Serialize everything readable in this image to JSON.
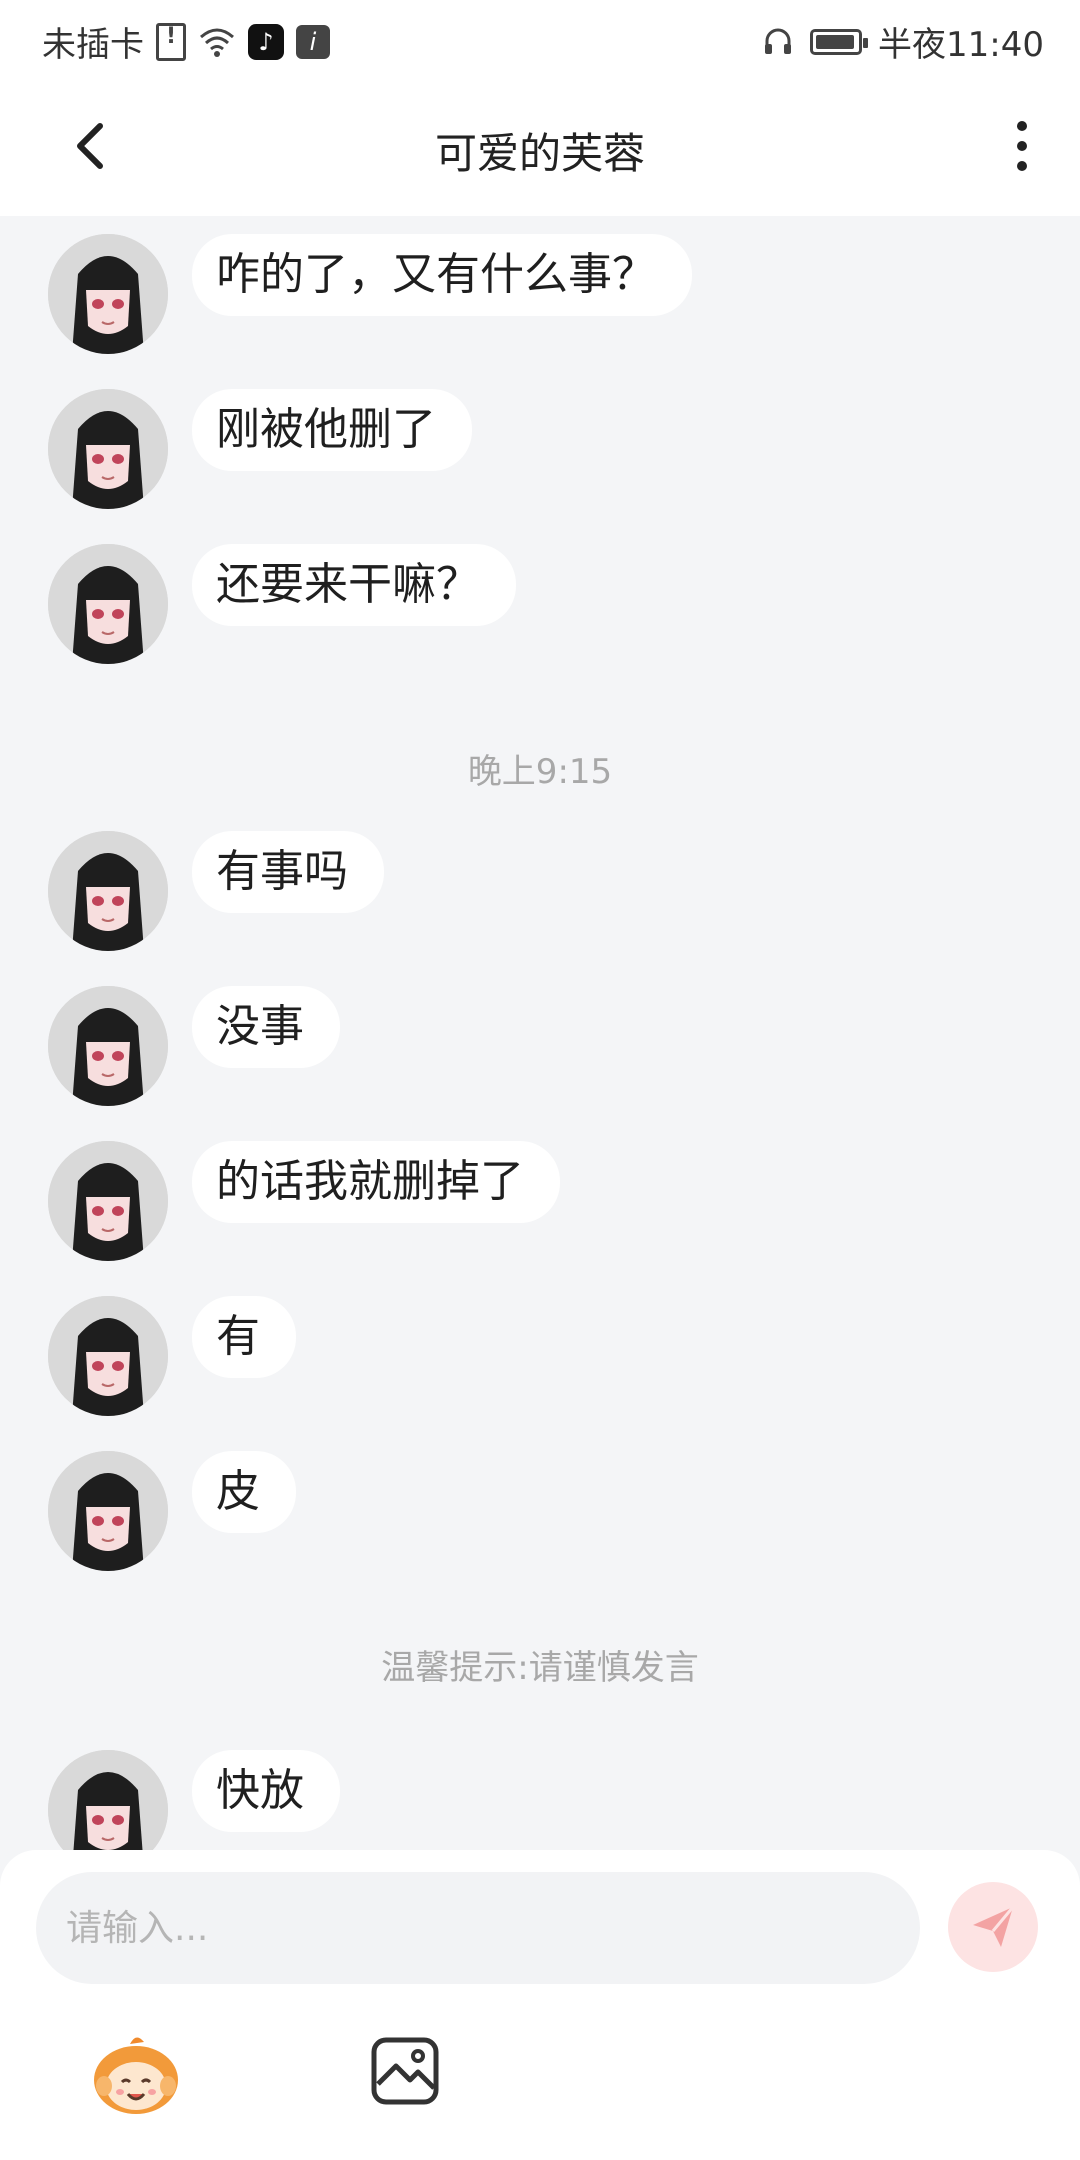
{
  "status_bar": {
    "carrier": "未插卡",
    "time": "半夜11:40",
    "icons": [
      "sim-alert-icon",
      "wifi-icon",
      "tiktok-icon",
      "info-icon",
      "headset-icon",
      "battery-icon"
    ]
  },
  "header": {
    "title": "可爱的芙蓉",
    "back_icon": "chevron-left-icon",
    "more_icon": "more-vertical-icon"
  },
  "messages": [
    {
      "text": "咋的了，又有什么事？"
    },
    {
      "text": "刚被他删了"
    },
    {
      "text": "还要来干嘛？"
    },
    {
      "text": "有事吗"
    },
    {
      "text": "没事"
    },
    {
      "text": "的话我就删掉了"
    },
    {
      "text": "有"
    },
    {
      "text": "皮"
    },
    {
      "text": "快放"
    }
  ],
  "system_labels": {
    "time_divider": "晚上9:15",
    "tip": "温馨提示:请谨慎发言"
  },
  "input": {
    "placeholder": "请输入...",
    "send_icon": "paper-plane-icon",
    "emoji_icon": "mascot-emoji-icon",
    "image_icon": "image-icon"
  },
  "colors": {
    "background": "#f4f5f7",
    "bubble": "#ffffff",
    "send_button": "#fde3e3",
    "send_icon": "#f3a3a3",
    "muted_text": "#a8a8a8"
  }
}
